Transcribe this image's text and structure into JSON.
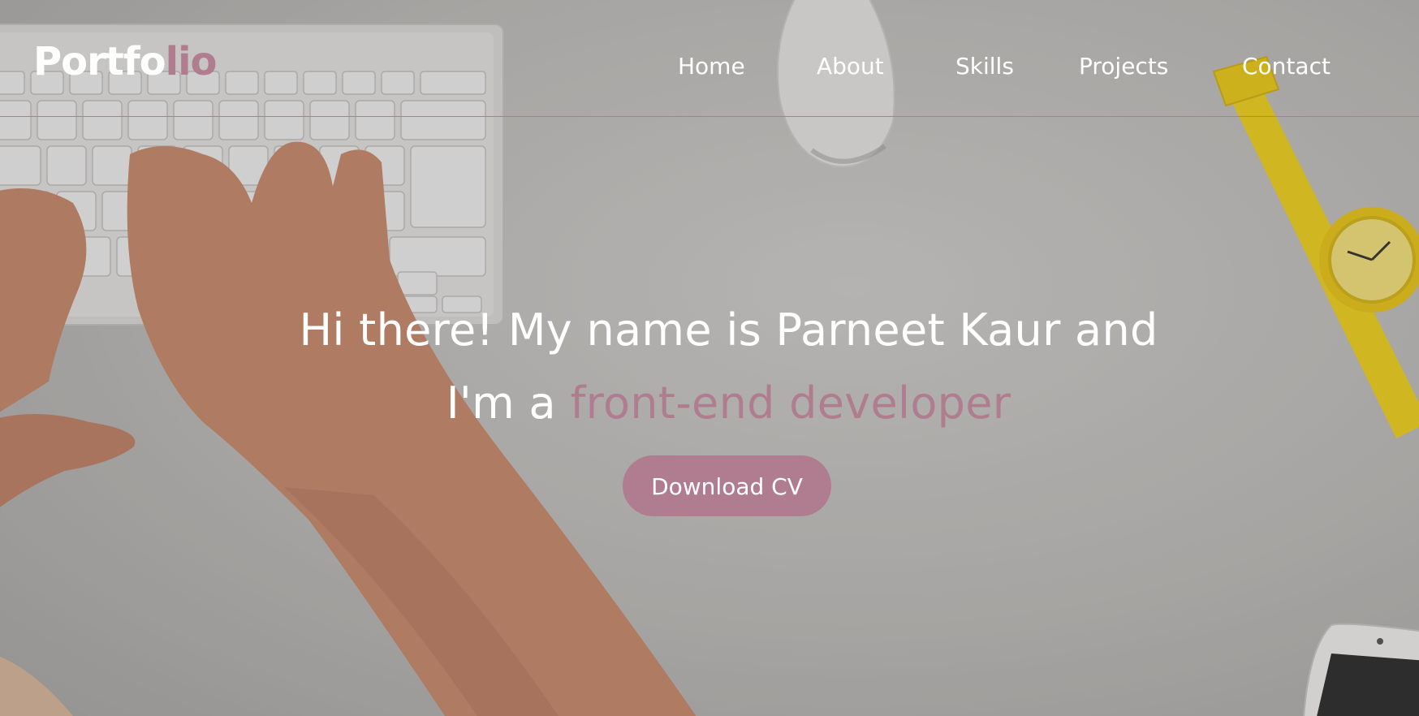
{
  "brand": {
    "logo_part1": "Portfo",
    "logo_part2": "lio",
    "accent_color": "#b07d90"
  },
  "nav": {
    "items": [
      {
        "label": "Home"
      },
      {
        "label": "About"
      },
      {
        "label": "Skills"
      },
      {
        "label": "Projects"
      },
      {
        "label": "Contact"
      }
    ]
  },
  "hero": {
    "line1": "Hi there! My name is Parneet Kaur and",
    "line2_prefix": "I'm a ",
    "line2_highlight": "front-end developer",
    "cta_label": "Download CV",
    "text_color": "#ffffff"
  }
}
